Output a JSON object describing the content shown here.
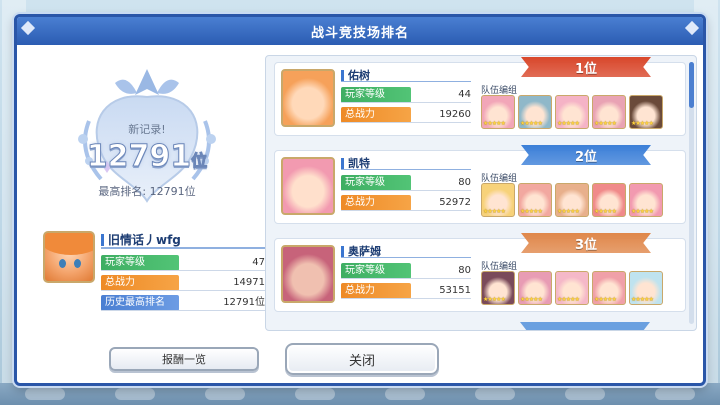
{
  "dialog": {
    "title": "战斗竞技场排名"
  },
  "record": {
    "new_record_label": "新记录!",
    "current_rank": "12791",
    "rank_unit": "位",
    "best_rank_text": "最高排名: 12791位"
  },
  "player": {
    "name": "旧情话丿wfg",
    "level_label": "玩家等级",
    "level": "47",
    "power_label": "总战力",
    "power": "14971",
    "history_label": "历史最高排名",
    "history_value": "12791位"
  },
  "reward_button": "报酬一览",
  "close_button": "关闭",
  "ranking": [
    {
      "rank_label": "1位",
      "rank_color": "#d9472b",
      "name": "佑树",
      "level_label": "玩家等级",
      "level": "44",
      "power_label": "总战力",
      "power": "19260",
      "team_label": "队伍编组",
      "avatar_colors": [
        "#f6a15a",
        "#ffd9b9"
      ],
      "team_colors": [
        "#f2a6b8",
        "#8fb8c9",
        "#f5b3c6",
        "#e9a3b4",
        "#6a4a3a"
      ]
    },
    {
      "rank_label": "2位",
      "rank_color": "#3b7fd8",
      "name": "凯特",
      "level_label": "玩家等级",
      "level": "80",
      "power_label": "总战力",
      "power": "52972",
      "team_label": "队伍编组",
      "avatar_colors": [
        "#f29ab0",
        "#ffe0cc"
      ],
      "team_colors": [
        "#f7d27a",
        "#f2a8a0",
        "#e8b08c",
        "#f08a8a",
        "#f29ab0"
      ]
    },
    {
      "rank_label": "3位",
      "rank_color": "#e0874a",
      "name": "奥萨姆",
      "level_label": "玩家等级",
      "level": "80",
      "power_label": "总战力",
      "power": "53151",
      "team_label": "队伍编组",
      "avatar_colors": [
        "#c7637a",
        "#f0c0b0"
      ],
      "team_colors": [
        "#7a4a5a",
        "#e89cb4",
        "#f5b8c8",
        "#f0a0a8",
        "#bfe3ef"
      ]
    }
  ]
}
